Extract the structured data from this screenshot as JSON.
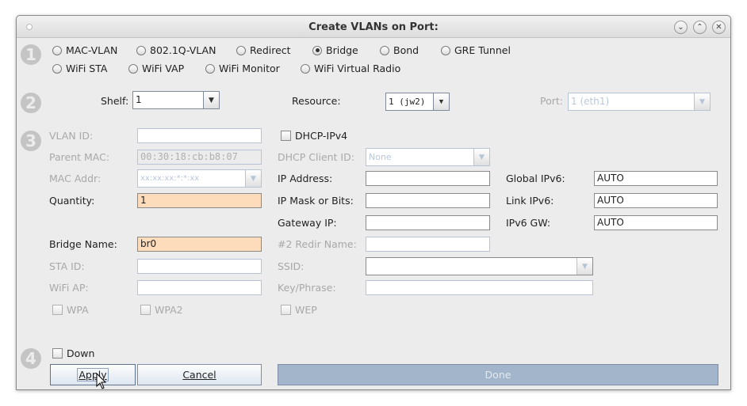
{
  "window": {
    "title": "Create VLANs on Port:",
    "buttons": {
      "minimize": "⌄",
      "maximize": "⌃",
      "close": "✕"
    }
  },
  "steps": [
    "1",
    "2",
    "3",
    "4"
  ],
  "types": [
    {
      "label": "MAC-VLAN",
      "selected": false
    },
    {
      "label": "802.1Q-VLAN",
      "selected": false
    },
    {
      "label": "Redirect",
      "selected": false
    },
    {
      "label": "Bridge",
      "selected": true
    },
    {
      "label": "Bond",
      "selected": false
    },
    {
      "label": "GRE Tunnel",
      "selected": false
    },
    {
      "label": "WiFi STA",
      "selected": false
    },
    {
      "label": "WiFi VAP",
      "selected": false
    },
    {
      "label": "WiFi Monitor",
      "selected": false
    },
    {
      "label": "WiFi Virtual Radio",
      "selected": false
    }
  ],
  "location": {
    "shelf_label": "Shelf:",
    "shelf_value": "1",
    "resource_label": "Resource:",
    "resource_value": "1 (jw2)",
    "port_label": "Port:",
    "port_value": "1 (eth1)"
  },
  "left": {
    "vlan_id": {
      "label": "VLAN ID:",
      "value": ""
    },
    "parent_mac": {
      "label": "Parent MAC:",
      "value": "00:30:18:cb:b8:07"
    },
    "mac_addr": {
      "label": "MAC Addr:",
      "value": "xx:xx:xx:*:*:xx"
    },
    "quantity": {
      "label": "Quantity:",
      "value": "1"
    },
    "bridge_name": {
      "label": "Bridge Name:",
      "value": "br0"
    },
    "sta_id": {
      "label": "STA ID:",
      "value": ""
    },
    "wifi_ap": {
      "label": "WiFi AP:",
      "value": ""
    },
    "wpa": "WPA",
    "wpa2": "WPA2"
  },
  "middle": {
    "dhcp_ipv4": "DHCP-IPv4",
    "dhcp_client_id": {
      "label": "DHCP Client ID:",
      "value": "None"
    },
    "ip_address": {
      "label": "IP Address:",
      "value": ""
    },
    "ip_mask": {
      "label": "IP Mask or Bits:",
      "value": ""
    },
    "gateway": {
      "label": "Gateway IP:",
      "value": ""
    },
    "redir_name": {
      "label": "#2 Redir Name:",
      "value": ""
    },
    "ssid": {
      "label": "SSID:",
      "value": ""
    },
    "key": {
      "label": "Key/Phrase:",
      "value": ""
    },
    "wep": "WEP"
  },
  "right": {
    "global_ipv6": {
      "label": "Global IPv6:",
      "value": "AUTO"
    },
    "link_ipv6": {
      "label": "Link IPv6:",
      "value": "AUTO"
    },
    "ipv6_gw": {
      "label": "IPv6 GW:",
      "value": "AUTO"
    }
  },
  "footer": {
    "down": "Down",
    "apply": "Apply",
    "cancel": "Cancel",
    "done": "Done"
  }
}
